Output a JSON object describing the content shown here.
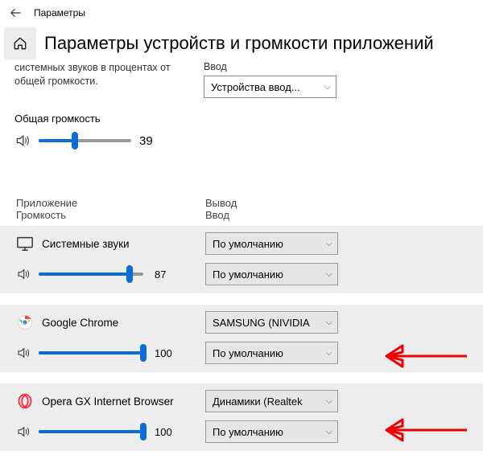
{
  "window": {
    "title": "Параметры"
  },
  "page": {
    "heading": "Параметры устройств и громкости приложений",
    "subtext_left": "системных звуков в процентах от общей громкости.",
    "subtext_right_label": "Ввод",
    "input_device_selected": "Устройства ввод...",
    "master_volume_label": "Общая громкость",
    "master_volume_value": "39"
  },
  "columns": {
    "left_line1": "Приложение",
    "left_line2": "Громкость",
    "right_line1": "Вывод",
    "right_line2": "Ввод"
  },
  "apps": {
    "system": {
      "name": "Системные звуки",
      "volume": "87",
      "output": "По умолчанию",
      "input": "По умолчанию"
    },
    "chrome": {
      "name": "Google Chrome",
      "volume": "100",
      "output": "SAMSUNG (NIVIDIA",
      "input": "По умолчанию"
    },
    "opera": {
      "name": "Opera GX Internet Browser",
      "volume": "100",
      "output": "Динамики (Realtek",
      "input": "По умолчанию"
    }
  }
}
